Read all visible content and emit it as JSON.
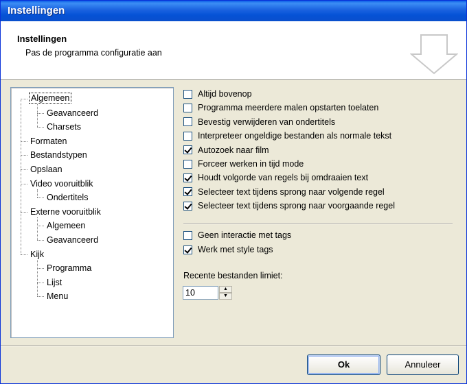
{
  "window": {
    "title": "Instellingen"
  },
  "header": {
    "title": "Instellingen",
    "subtitle": "Pas de programma configuratie aan",
    "icon": "down-arrow-icon"
  },
  "tree": {
    "items": [
      {
        "label": "Algemeen",
        "level": 0,
        "selected": true
      },
      {
        "label": "Geavanceerd",
        "level": 1
      },
      {
        "label": "Charsets",
        "level": 1
      },
      {
        "label": "Formaten",
        "level": 0
      },
      {
        "label": "Bestandstypen",
        "level": 0
      },
      {
        "label": "Opslaan",
        "level": 0
      },
      {
        "label": "Video vooruitblik",
        "level": 0
      },
      {
        "label": "Ondertitels",
        "level": 1
      },
      {
        "label": "Externe vooruitblik",
        "level": 0
      },
      {
        "label": "Algemeen",
        "level": 1
      },
      {
        "label": "Geavanceerd",
        "level": 1
      },
      {
        "label": "Kijk",
        "level": 0
      },
      {
        "label": "Programma",
        "level": 1
      },
      {
        "label": "Lijst",
        "level": 1
      },
      {
        "label": "Menu",
        "level": 1
      }
    ]
  },
  "options": {
    "group1": [
      {
        "label": "Altijd bovenop",
        "checked": false
      },
      {
        "label": "Programma meerdere malen opstarten toelaten",
        "checked": false
      },
      {
        "label": "Bevestig verwijderen van ondertitels",
        "checked": false
      },
      {
        "label": "Interpreteer ongeldige bestanden als normale tekst",
        "checked": false
      },
      {
        "label": "Autozoek naar film",
        "checked": true
      },
      {
        "label": "Forceer werken in tijd mode",
        "checked": false
      },
      {
        "label": "Houdt volgorde van regels bij omdraaien text",
        "checked": true
      },
      {
        "label": "Selecteer text tijdens sprong naar volgende regel",
        "checked": true
      },
      {
        "label": "Selecteer text tijdens sprong naar voorgaande regel",
        "checked": true
      }
    ],
    "group2": [
      {
        "label": "Geen interactie met tags",
        "checked": false
      },
      {
        "label": "Werk met style tags",
        "checked": true
      }
    ]
  },
  "recent": {
    "label": "Recente bestanden limiet:",
    "value": "10"
  },
  "buttons": {
    "ok_label": "Ok",
    "cancel_label": "Annuleer"
  }
}
